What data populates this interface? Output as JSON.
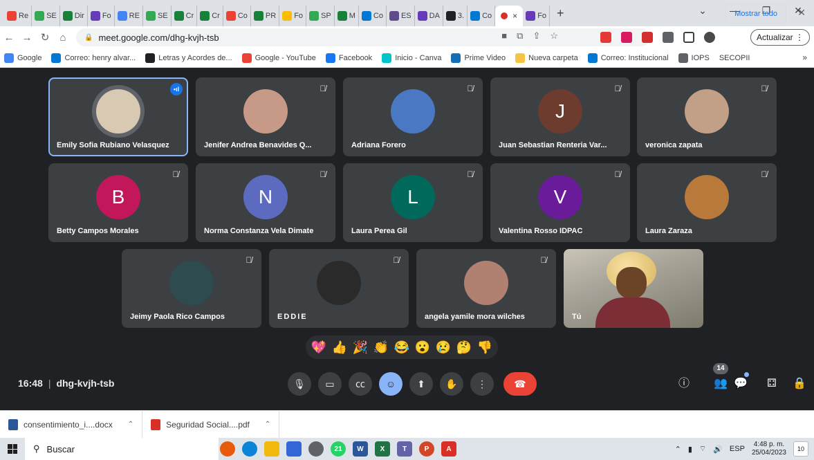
{
  "browser": {
    "tabs": [
      {
        "label": "Re",
        "color": "#ea4335"
      },
      {
        "label": "SE",
        "color": "#34a853"
      },
      {
        "label": "Dir",
        "color": "#188038"
      },
      {
        "label": "Fo",
        "color": "#673ab7"
      },
      {
        "label": "RE",
        "color": "#4285f4"
      },
      {
        "label": "SE",
        "color": "#34a853"
      },
      {
        "label": "Cr",
        "color": "#188038"
      },
      {
        "label": "Cr",
        "color": "#188038"
      },
      {
        "label": "Co",
        "color": "#ea4335"
      },
      {
        "label": "PR",
        "color": "#188038"
      },
      {
        "label": "Fo",
        "color": "#fbbc04"
      },
      {
        "label": "SP",
        "color": "#34a853"
      },
      {
        "label": "M",
        "color": "#188038"
      },
      {
        "label": "Co",
        "color": "#0078d4"
      },
      {
        "label": "ES",
        "color": "#5f4b8b"
      },
      {
        "label": "DA",
        "color": "#673ab7"
      },
      {
        "label": "3.",
        "color": "#202124"
      },
      {
        "label": "Co",
        "color": "#0078d4"
      }
    ],
    "active_tab_close": "×",
    "next_tab": {
      "label": "Fo",
      "color": "#673ab7"
    },
    "new_tab": "+",
    "url": "meet.google.com/dhg-kvjh-tsb",
    "update_button": "Actualizar",
    "bookmarks": [
      {
        "label": "Google",
        "color": "#4285f4"
      },
      {
        "label": "Correo: henry alvar...",
        "color": "#0078d4"
      },
      {
        "label": "Letras y Acordes de...",
        "color": "#202124"
      },
      {
        "label": "Google - YouTube",
        "color": "#ea4335"
      },
      {
        "label": "Facebook",
        "color": "#1877f2"
      },
      {
        "label": "Inicio - Canva",
        "color": "#00c4cc"
      },
      {
        "label": "Prime Video",
        "color": "#146eb4"
      },
      {
        "label": "Nueva carpeta",
        "color": "#f5c542"
      },
      {
        "label": "Correo: Institucional",
        "color": "#0078d4"
      },
      {
        "label": "IOPS",
        "color": "#5f6368"
      },
      {
        "label": "SECOPII",
        "color": "#ffffff"
      }
    ],
    "bookmarks_more": "»"
  },
  "meet": {
    "participants": [
      {
        "name": "Emily Sofia Rubiano Velasquez",
        "speaking": true,
        "avatar": "photo",
        "avatar_color": "#d8c9b2"
      },
      {
        "name": "Jenifer Andrea Benavides Q...",
        "muted": true,
        "avatar": "photo",
        "avatar_color": "#c69a86"
      },
      {
        "name": "Adriana Forero",
        "muted": true,
        "avatar": "photo",
        "avatar_color": "#4a78c2"
      },
      {
        "name": "Juan Sebastian Renteria Var...",
        "muted": true,
        "initial": "J",
        "avatar_color": "#6d3c2f"
      },
      {
        "name": "veronica zapata",
        "muted": true,
        "avatar": "photo",
        "avatar_color": "#c2a087"
      },
      {
        "name": "Betty Campos Morales",
        "muted": true,
        "initial": "B",
        "avatar_color": "#c2185b"
      },
      {
        "name": "Norma Constanza Vela Dimate",
        "muted": true,
        "initial": "N",
        "avatar_color": "#5c6bc0"
      },
      {
        "name": "Laura Perea Gil",
        "muted": true,
        "initial": "L",
        "avatar_color": "#00695c"
      },
      {
        "name": "Valentina Rosso IDPAC",
        "muted": true,
        "initial": "V",
        "avatar_color": "#6a1b9a"
      },
      {
        "name": "Laura Zaraza",
        "muted": true,
        "avatar": "photo",
        "avatar_color": "#b9793a"
      },
      {
        "name": "Jeimy Paola Rico Campos",
        "muted": true,
        "avatar": "photo",
        "avatar_color": "#2e4b4f"
      },
      {
        "name": "EDDIE",
        "muted": true,
        "avatar": "photo",
        "avatar_color": "#2a2a2a"
      },
      {
        "name": "angela yamile mora wilches",
        "muted": true,
        "avatar": "photo",
        "avatar_color": "#b08070"
      }
    ],
    "self_name": "Tú",
    "reactions": [
      "💖",
      "👍",
      "🎉",
      "👏",
      "😂",
      "😮",
      "😢",
      "🤔",
      "👎"
    ],
    "time": "16:48",
    "meeting_code": "dhg-kvjh-tsb",
    "participant_count": "14",
    "accent": "#8ab4f8",
    "end_call_color": "#ea4335"
  },
  "downloads": {
    "items": [
      {
        "name": "consentimiento_i....docx",
        "icon_color": "#2b579a"
      },
      {
        "name": "Seguridad Social....pdf",
        "icon_color": "#d93025"
      }
    ],
    "show_all": "Mostrar todo"
  },
  "taskbar": {
    "search_placeholder": "Buscar",
    "teams_badge": "21",
    "language": "ESP",
    "time": "4:48 p. m.",
    "date": "25/04/2023",
    "notifications": "10"
  }
}
